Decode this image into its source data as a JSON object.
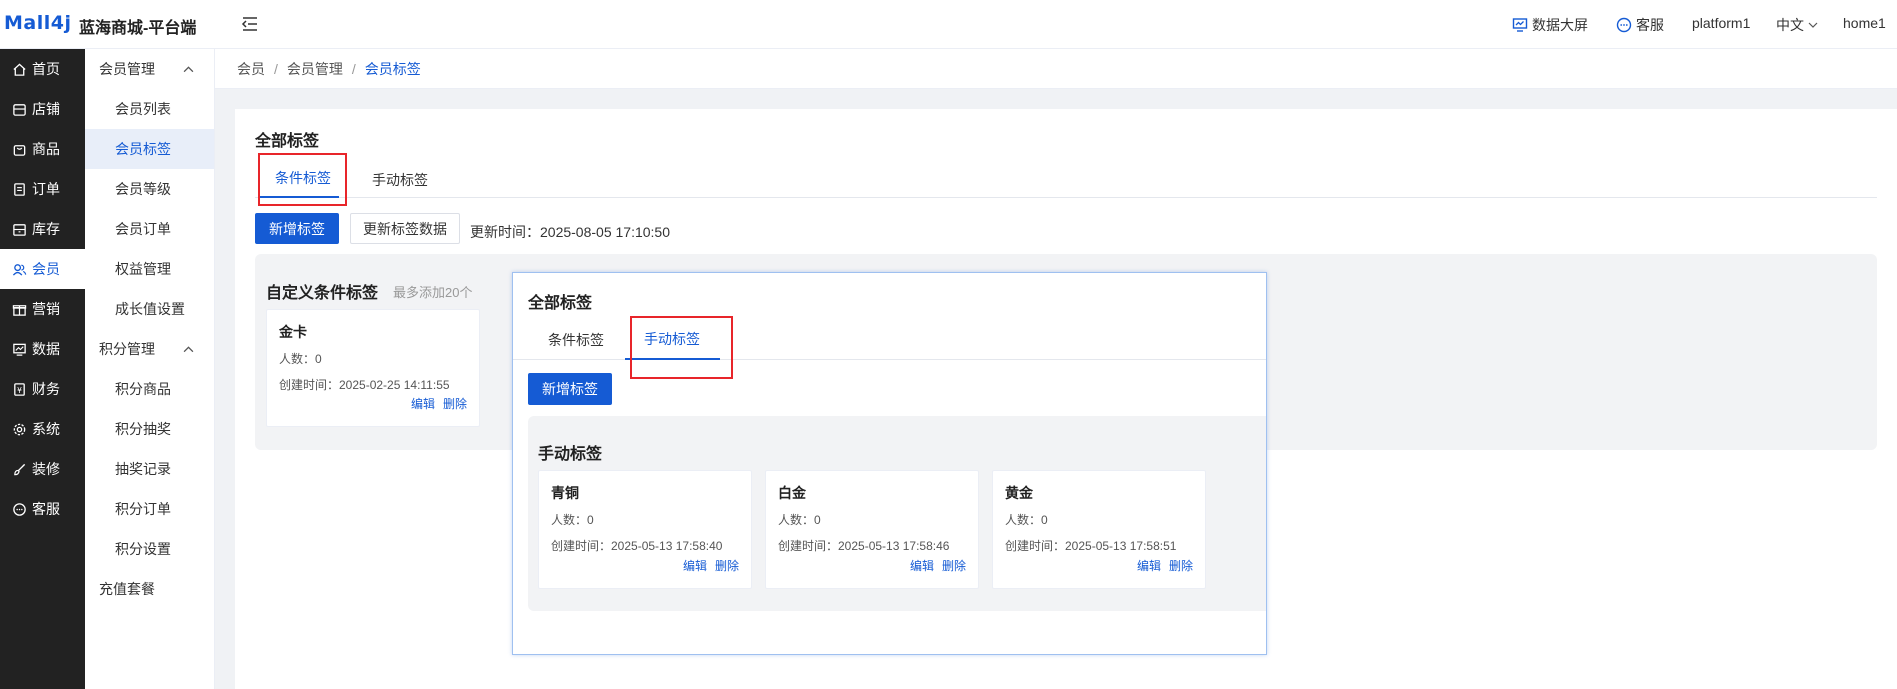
{
  "header": {
    "logo": "Mall4j",
    "title": "蓝海商城-平台端",
    "data_screen": "数据大屏",
    "service": "客服",
    "user": "platform1",
    "language": "中文",
    "home": "home1"
  },
  "sidenav": {
    "items": [
      {
        "label": "首页",
        "icon": "home-icon"
      },
      {
        "label": "店铺",
        "icon": "shop-icon"
      },
      {
        "label": "商品",
        "icon": "bag-icon"
      },
      {
        "label": "订单",
        "icon": "order-icon"
      },
      {
        "label": "库存",
        "icon": "stock-icon"
      },
      {
        "label": "会员",
        "icon": "member-icon"
      },
      {
        "label": "营销",
        "icon": "gift-icon"
      },
      {
        "label": "数据",
        "icon": "chart-icon"
      },
      {
        "label": "财务",
        "icon": "finance-icon"
      },
      {
        "label": "系统",
        "icon": "gear-icon"
      },
      {
        "label": "装修",
        "icon": "brush-icon"
      },
      {
        "label": "客服",
        "icon": "chat-icon"
      }
    ]
  },
  "submenu": {
    "group1": "会员管理",
    "items1": [
      "会员列表",
      "会员标签",
      "会员等级",
      "会员订单",
      "权益管理",
      "成长值设置"
    ],
    "group2": "积分管理",
    "items2": [
      "积分商品",
      "积分抽奖",
      "抽奖记录",
      "积分订单",
      "积分设置"
    ],
    "group3": "充值套餐"
  },
  "breadcrumb": [
    "会员",
    "会员管理",
    "会员标签"
  ],
  "main": {
    "title": "全部标签",
    "tab_condition": "条件标签",
    "tab_manual": "手动标签",
    "add_button": "新增标签",
    "refresh_button": "更新标签数据",
    "update_time": "更新时间：2025-08-05 17:10:50",
    "custom_title": "自定义条件标签",
    "custom_hint": "最多添加20个",
    "card": {
      "name": "金卡",
      "count": "人数：0",
      "time": "创建时间：2025-02-25 14:11:55",
      "edit": "编辑",
      "delete": "删除"
    }
  },
  "overlay": {
    "title": "全部标签",
    "tab_condition": "条件标签",
    "tab_manual": "手动标签",
    "add_button": "新增标签",
    "panel_title": "手动标签",
    "cards": [
      {
        "name": "青铜",
        "count": "人数：0",
        "time": "创建时间：2025-05-13 17:58:40",
        "edit": "编辑",
        "delete": "删除"
      },
      {
        "name": "白金",
        "count": "人数：0",
        "time": "创建时间：2025-05-13 17:58:46",
        "edit": "编辑",
        "delete": "删除"
      },
      {
        "name": "黄金",
        "count": "人数：0",
        "time": "创建时间：2025-05-13 17:58:51",
        "edit": "编辑",
        "delete": "删除"
      }
    ]
  },
  "colors": {
    "accent": "#155bd4",
    "sidebar": "#222222",
    "highlight": "#e8252a"
  }
}
